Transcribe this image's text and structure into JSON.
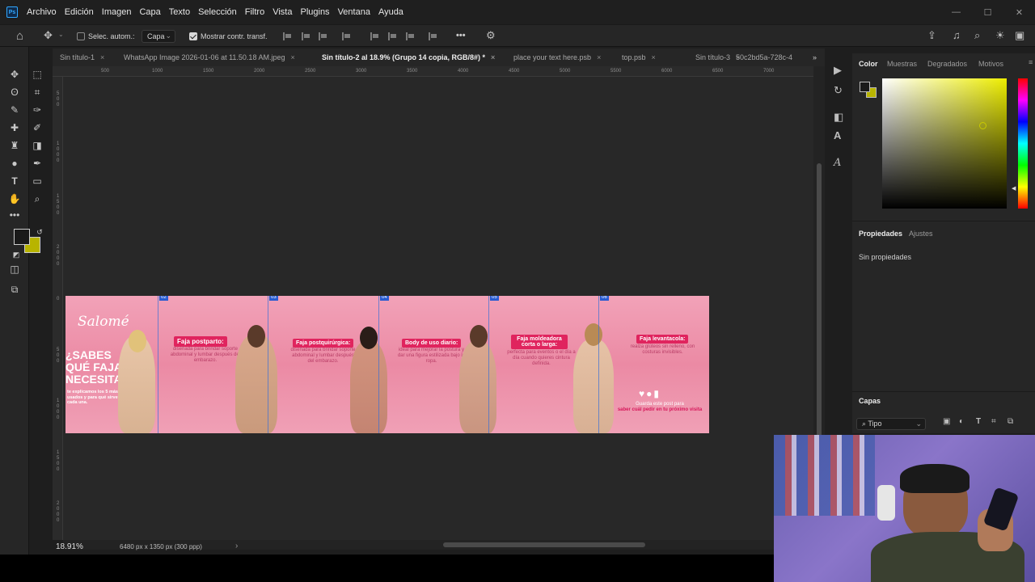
{
  "menu": {
    "logo": "Ps",
    "items": [
      "Archivo",
      "Edición",
      "Imagen",
      "Capa",
      "Texto",
      "Selección",
      "Filtro",
      "Vista",
      "Plugins",
      "Ventana",
      "Ayuda"
    ],
    "window_controls": [
      "—",
      "☐",
      "✕"
    ]
  },
  "options": {
    "auto_select_label": "Selec. autom.:",
    "auto_select_checked": false,
    "target_value": "Capa",
    "transform_label": "Mostrar contr. transf.",
    "transform_checked": true,
    "more_label": "•••"
  },
  "tabs": [
    {
      "label": "Sin título-1",
      "active": false
    },
    {
      "label": "WhatsApp Image 2026-01-06 at 11.50.18 AM.jpeg",
      "active": false
    },
    {
      "label": "Sin título-2 al 18.9% (Grupo 14 copia, RGB/8#) *",
      "active": true
    },
    {
      "label": "place your text here.psb",
      "active": false
    },
    {
      "label": "top.psb",
      "active": false
    },
    {
      "label": "Sin título-3",
      "active": false
    },
    {
      "label": "50c2bd5a-728c-4",
      "active": false
    }
  ],
  "ruler": {
    "top_ticks": [
      "500",
      "1000",
      "1500",
      "2000",
      "2500",
      "3000",
      "3500",
      "4000",
      "4500",
      "5000",
      "5500",
      "6000",
      "6500",
      "7000"
    ],
    "left_ticks": [
      "0",
      "5\n0\n0",
      "1\n0\n0\n0",
      "1\n5\n0\n0",
      "2\n0\n0\n0",
      "0",
      "5\n0\n0",
      "1\n0\n0\n0",
      "1\n5\n0\n0",
      "2\n0\n0\n0"
    ]
  },
  "status": {
    "zoom": "18.91%",
    "doc_info": "6480 px x 1350 px (300 ppp)"
  },
  "banner": {
    "brand": "Salomé",
    "headline_lines": [
      "¿SABES",
      "QUÉ FAJA",
      "NECESITAS?"
    ],
    "intro_text": "te explicamos los 5 más usados y para qué sirve cada una.",
    "artboards": [
      "02",
      "03",
      "04",
      "05",
      "06"
    ],
    "products": [
      {
        "title": "Faja postparto:",
        "text": "diseñada para brindar soporte abdominal y lumbar después del embarazo."
      },
      {
        "title": "Faja postquirúrgica:",
        "text": "diseñada para brindar soporte abdominal y lumbar después del embarazo."
      },
      {
        "title": "Body de uso diario:",
        "text": "ideal para mejorar la postura y dar una figura estilizada bajo la ropa."
      },
      {
        "title": "Faja moldeadora corta o larga:",
        "text": "perfecta para eventos o el día a día cuando quieres cintura definida."
      },
      {
        "title": "Faja levantacola:",
        "text": "realza glúteos sin relleno, con costuras invisibles."
      }
    ],
    "cta_small": "Guarda este post para",
    "cta_bold": "saber cuál pedir en tu próximo visita"
  },
  "color_panel": {
    "tabs": [
      "Color",
      "Muestras",
      "Degradados",
      "Motivos"
    ],
    "fg_color": "#1a1a1a",
    "bg_color": "#b8b400"
  },
  "properties_panel": {
    "tabs": [
      "Propiedades",
      "Ajustes"
    ],
    "message": "Sin propiedades"
  },
  "layers_panel": {
    "title": "Capas",
    "filter_label": "Tipo"
  },
  "colors": {
    "accent_blue": "#31a8ff",
    "banner_pink": "#eb8aa4",
    "pill_pink": "#e0245e"
  }
}
